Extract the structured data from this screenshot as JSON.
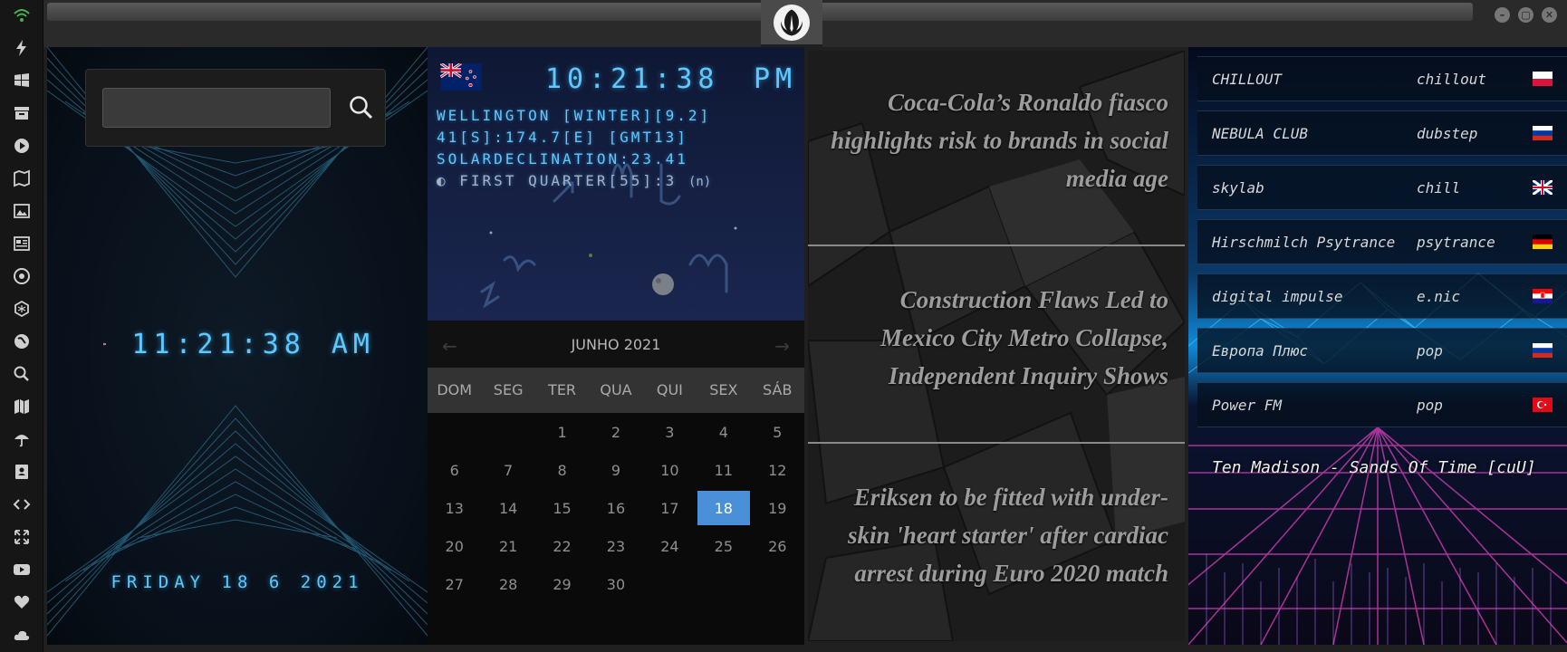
{
  "titlebar": {
    "controls": [
      "–",
      "▢",
      "✕"
    ]
  },
  "clock_panel": {
    "search": {
      "value": "",
      "placeholder": ""
    },
    "time": "11:21:38",
    "ampm": "AM",
    "date": "FRIDAY 18 6 2021"
  },
  "astro_panel": {
    "time": "10:21:38",
    "ampm": "PM",
    "line1": "WELLINGTON [WINTER][9.2]",
    "line2": "41[S]:174.7[E] [GMT13]",
    "line3": "SOLARDECLINATION:23.41",
    "moon": "FIRST QUARTER[55]:3",
    "moon_suffix": "(n)"
  },
  "calendar": {
    "month_label": "JUNHO 2021",
    "prev": "←",
    "next": "→",
    "weekdays": [
      "DOM",
      "SEG",
      "TER",
      "QUA",
      "QUI",
      "SEX",
      "SÁB"
    ],
    "weeks": [
      [
        "",
        "",
        "1",
        "2",
        "3",
        "4",
        "5"
      ],
      [
        "6",
        "7",
        "8",
        "9",
        "10",
        "11",
        "12"
      ],
      [
        "13",
        "14",
        "15",
        "16",
        "17",
        "18",
        "19"
      ],
      [
        "20",
        "21",
        "22",
        "23",
        "24",
        "25",
        "26"
      ],
      [
        "27",
        "28",
        "29",
        "30",
        "",
        "",
        ""
      ]
    ],
    "today": "18"
  },
  "news": [
    {
      "headline": "Coca-Cola’s Ronaldo fiasco highlights risk to brands in social media age"
    },
    {
      "headline": "Construction Flaws Led to Mexico City Metro Collapse, Independent Inquiry Shows"
    },
    {
      "headline": "Eriksen to be fitted with under-skin 'heart starter' after cardiac arrest during Euro 2020 match"
    }
  ],
  "radio": {
    "stations": [
      {
        "name": "CHILLOUT",
        "genre": "chillout",
        "flag": "poland"
      },
      {
        "name": "NEBULA CLUB",
        "genre": "dubstep",
        "flag": "russia"
      },
      {
        "name": "skylab",
        "genre": "chill",
        "flag": "uk"
      },
      {
        "name": "Hirschmilch Psytrance",
        "genre": "psytrance",
        "flag": "germany"
      },
      {
        "name": "digital impulse",
        "genre": "e.nic",
        "flag": "croatia"
      },
      {
        "name": "Европа Плюс",
        "genre": "pop",
        "flag": "russia"
      },
      {
        "name": "Power FM",
        "genre": "pop",
        "flag": "turkey"
      }
    ],
    "now_playing": "Ten Madison - Sands Of Time [cuU]"
  },
  "colors": {
    "lcd": "#5ec9ff",
    "today": "#4a90d9"
  }
}
